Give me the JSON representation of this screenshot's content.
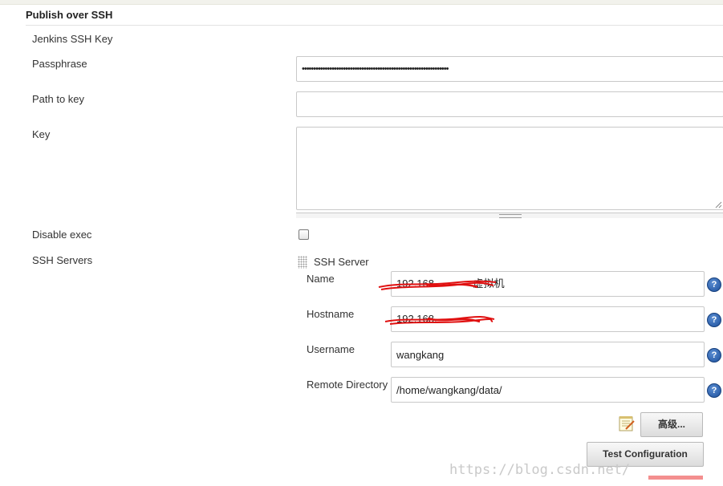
{
  "section": {
    "title": "Publish over SSH"
  },
  "jenkins_ssh_key": {
    "title": "Jenkins SSH Key"
  },
  "fields": {
    "passphrase": {
      "label": "Passphrase",
      "value": "••••••••••••••••••••••••••••••••••••••••••••••••••••••••••••••••"
    },
    "path_to_key": {
      "label": "Path to key",
      "value": ""
    },
    "key": {
      "label": "Key",
      "value": ""
    },
    "disable_exec": {
      "label": "Disable exec",
      "checked": false
    }
  },
  "ssh_servers": {
    "label": "SSH Servers",
    "server": {
      "title": "SSH Server",
      "name": {
        "label": "Name",
        "value": "192.168.",
        "suffix": "虚拟机"
      },
      "hostname": {
        "label": "Hostname",
        "value": "192.168."
      },
      "username": {
        "label": "Username",
        "value": "wangkang"
      },
      "remote_directory": {
        "label": "Remote Directory",
        "value": "/home/wangkang/data/"
      }
    }
  },
  "buttons": {
    "advanced": "高级...",
    "test_configuration": "Test Configuration"
  },
  "help_icon_text": "?",
  "watermark": "https://blog.csdn.net/",
  "colors": {
    "redact": "#e01010",
    "help": "#1c4f9b"
  }
}
